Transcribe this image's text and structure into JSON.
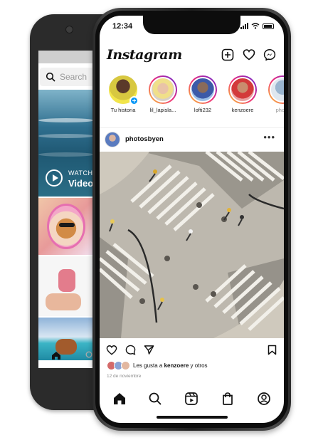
{
  "back_phone": {
    "search_placeholder": "Search",
    "watch_label": "WATCH",
    "video_label": "Video"
  },
  "front_phone": {
    "status": {
      "time": "12:34"
    },
    "header": {
      "logo": "Instagram"
    },
    "stories": [
      {
        "name": "Tu historia",
        "ring": "none",
        "has_add": true
      },
      {
        "name": "lil_lapisla...",
        "ring": "gradient",
        "has_add": false
      },
      {
        "name": "lofti232",
        "ring": "gradient",
        "has_add": false
      },
      {
        "name": "kenzoere",
        "ring": "gradient",
        "has_add": false
      },
      {
        "name": "photo",
        "ring": "plain",
        "has_add": false
      }
    ],
    "post": {
      "username": "photosbyen",
      "more": "•••",
      "likes_prefix": "Les gusta a",
      "likes_user": "kenzoere",
      "likes_suffix": "y otros",
      "date": "12 de noviembre"
    },
    "tabs": [
      "home-icon",
      "search-icon",
      "reels-icon",
      "shop-icon",
      "profile-icon"
    ]
  },
  "colors": {
    "accent_blue": "#0095f6",
    "story_gradient": [
      "#f9ce34",
      "#ee2a7b",
      "#6228d7"
    ]
  }
}
